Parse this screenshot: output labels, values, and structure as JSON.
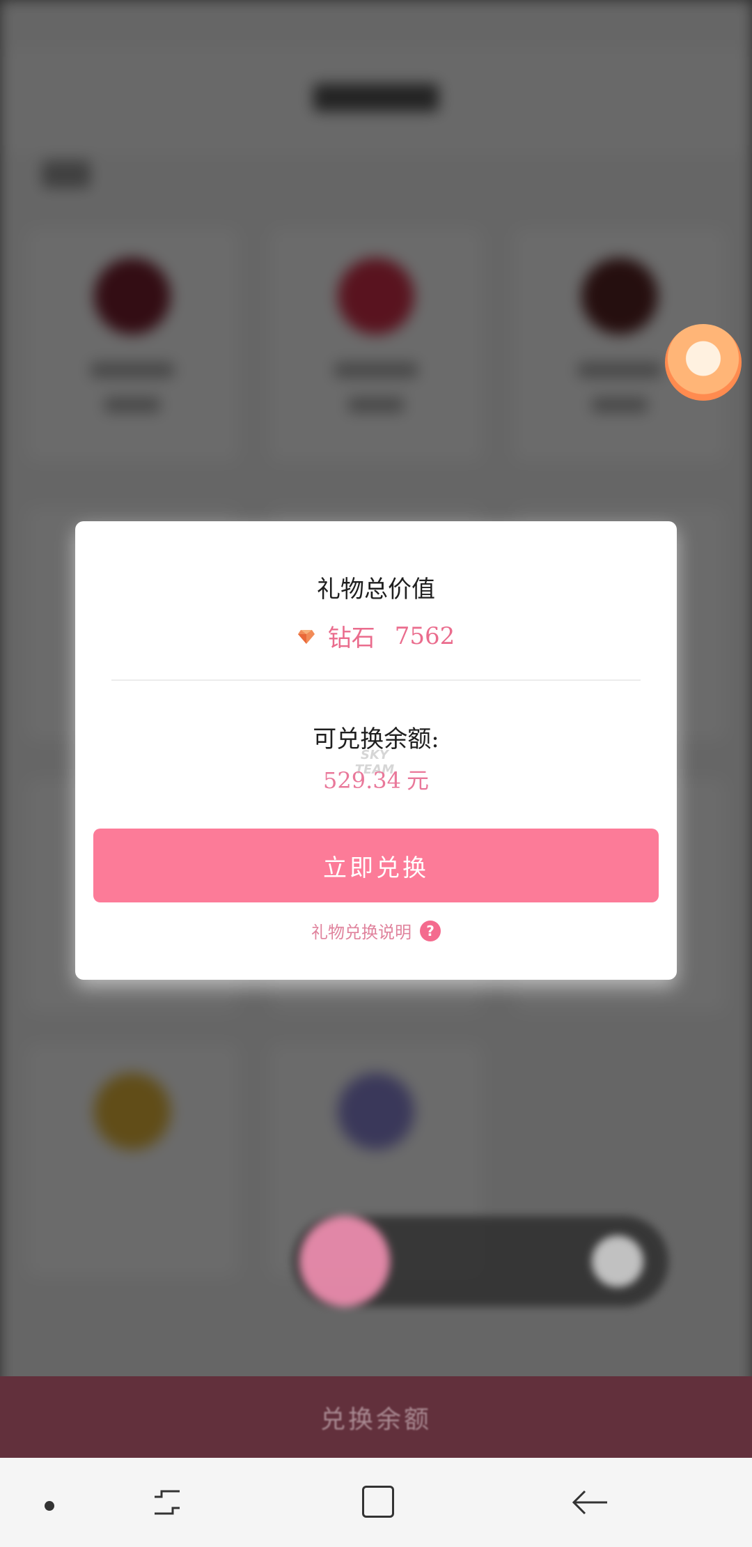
{
  "modal": {
    "title": "礼物总价值",
    "diamond_label": "钻石",
    "diamond_value": "7562",
    "balance_label": "可兑换余额:",
    "balance_amount": "529.34",
    "balance_unit": "元",
    "watermark": "SKY TEAM",
    "exchange_button": "立即兑换",
    "help_text": "礼物兑换说明",
    "help_icon": "?"
  },
  "bottom_bar": {
    "label": "兑换余额"
  },
  "icons": {
    "diamond": "diamond-icon",
    "help": "question-circle-icon",
    "recents": "recents-icon",
    "home": "home-icon",
    "back": "back-arrow-icon"
  },
  "colors": {
    "accent": "#fc7b98",
    "accent_text": "#ea6c8d",
    "bottom_bar": "#62303c",
    "overlay": "#6b6b6b"
  }
}
